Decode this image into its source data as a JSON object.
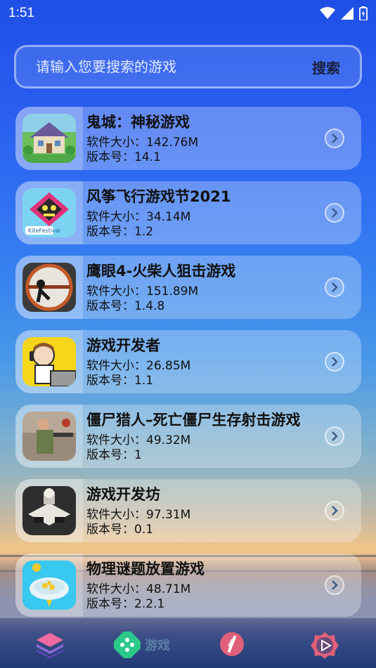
{
  "status": {
    "time": "1:51"
  },
  "search": {
    "placeholder": "请输入您要搜索的游戏",
    "button": "搜索"
  },
  "games": [
    {
      "title": "鬼城：神秘游戏",
      "size": "软件大小：142.76M",
      "version": "版本号：14.1",
      "icon": "house-game-icon"
    },
    {
      "title": "风筝飞行游戏节2021",
      "size": "软件大小：34.14M",
      "version": "版本号：1.2",
      "icon": "kite-festival-icon"
    },
    {
      "title": "鹰眼4-火柴人狙击游戏",
      "size": "软件大小：151.89M",
      "version": "版本号：1.4.8",
      "icon": "sniper-icon"
    },
    {
      "title": "游戏开发者",
      "size": "软件大小：26.85M",
      "version": "版本号：1.1",
      "icon": "developer-girl-icon"
    },
    {
      "title": "僵尸猎人–死亡僵尸生存射击游戏",
      "size": "软件大小：49.32M",
      "version": "版本号：1",
      "icon": "zombie-hunter-icon"
    },
    {
      "title": "游戏开发坊",
      "size": "软件大小：97.31M",
      "version": "版本号：0.1",
      "icon": "dev-studio-icon"
    },
    {
      "title": "物理谜题放置游戏",
      "size": "软件大小：48.71M",
      "version": "版本号：2.2.1",
      "icon": "physics-puzzle-icon"
    }
  ],
  "nav": {
    "games_label": "游戏"
  },
  "colors": {
    "accent_pink": "#e0607a",
    "accent_green": "#2bc98a",
    "title_text": "#111111"
  }
}
